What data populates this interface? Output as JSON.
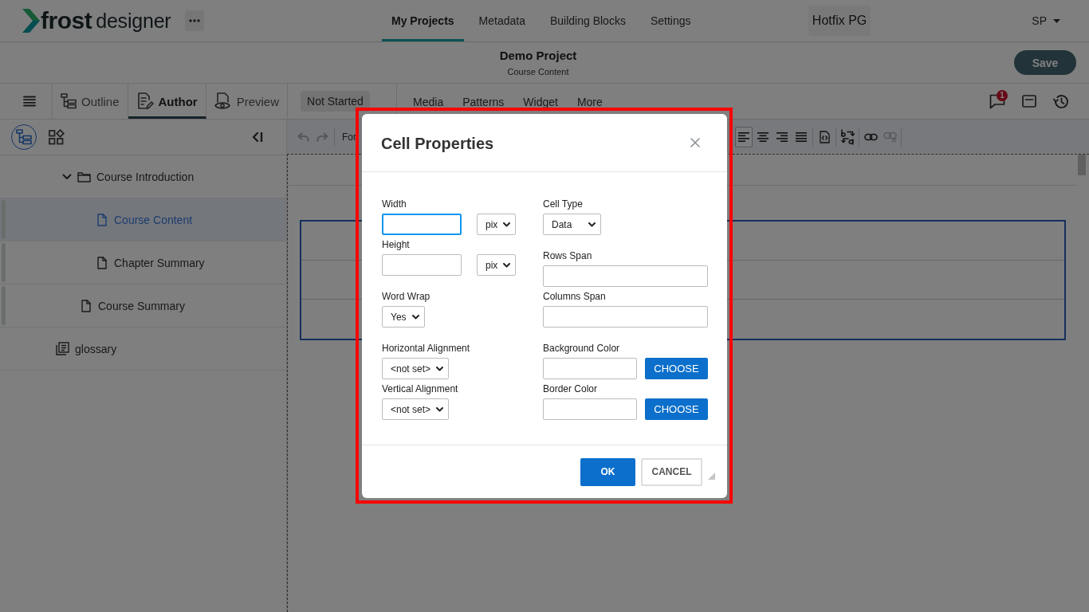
{
  "app_header": {
    "logo": {
      "bold_part": "frost",
      "light_part": "designer"
    },
    "nav": [
      {
        "label": "My Projects",
        "selected": true
      },
      {
        "label": "Metadata",
        "selected": false
      },
      {
        "label": "Building Blocks",
        "selected": false
      },
      {
        "label": "Settings",
        "selected": false
      }
    ],
    "workspace": "Hotfix PG",
    "user": "SP"
  },
  "project_bar": {
    "title": "Demo Project",
    "subtitle": "Course Content",
    "save_button": "Save"
  },
  "mode_tabs": [
    {
      "label": "Outline",
      "selected": false
    },
    {
      "label": "Author",
      "selected": true
    },
    {
      "label": "Preview",
      "selected": false
    }
  ],
  "status": "Not Started",
  "insert_menu": [
    "Media",
    "Patterns",
    "Widget",
    "More"
  ],
  "notifications": {
    "count": "1"
  },
  "sidebar": {
    "views": [
      {
        "selected": true
      },
      {
        "selected": false
      }
    ],
    "tree": [
      {
        "label": "Course Introduction",
        "kind": "folder",
        "expanded": true,
        "selected": false,
        "children": [
          {
            "label": "Course Content",
            "kind": "page",
            "selected": true
          },
          {
            "label": "Chapter Summary",
            "kind": "page",
            "selected": false
          }
        ]
      },
      {
        "label": "Course Summary",
        "kind": "page",
        "selected": false
      },
      {
        "label": "glossary",
        "kind": "glossary",
        "selected": false
      }
    ]
  },
  "editor_toolbar": {
    "history": [
      {
        "disabled": true
      },
      {
        "disabled": true
      }
    ],
    "format": "For",
    "align": [
      {
        "selected": true
      },
      {
        "selected": false
      },
      {
        "selected": false
      },
      {
        "selected": false
      }
    ],
    "tools": [
      {
        "disabled": false
      },
      {
        "disabled": false
      },
      {
        "disabled": false
      },
      {
        "disabled": true
      }
    ]
  },
  "dialog": {
    "title": "Cell Properties",
    "highlighted": true,
    "columns": [
      [
        [
          {
            "kind": "measure",
            "label": "Width",
            "unit": "pix",
            "focused": true
          },
          {
            "kind": "measure",
            "label": "Height",
            "unit": "pix",
            "focused": false
          }
        ],
        [
          {
            "kind": "select",
            "label": "Word Wrap",
            "value": "Yes"
          }
        ],
        [
          {
            "kind": "select",
            "label": "Horizontal Alignment",
            "value": "<not set>"
          },
          {
            "kind": "select",
            "label": "Vertical Alignment",
            "value": "<not set>"
          }
        ]
      ],
      [
        [
          {
            "kind": "select",
            "label": "Cell Type",
            "value": "Data"
          }
        ],
        [
          {
            "kind": "text",
            "label": "Rows Span",
            "focused": false
          },
          {
            "kind": "text",
            "label": "Columns Span",
            "focused": false
          }
        ],
        [
          {
            "kind": "color",
            "label": "Background Color",
            "button": "CHOOSE",
            "focused": false
          },
          {
            "kind": "color",
            "label": "Border Color",
            "button": "CHOOSE",
            "focused": false
          }
        ]
      ]
    ],
    "buttons": [
      {
        "label": "OK",
        "kind": "primary"
      },
      {
        "label": "CANCEL",
        "kind": "secondary"
      }
    ]
  }
}
